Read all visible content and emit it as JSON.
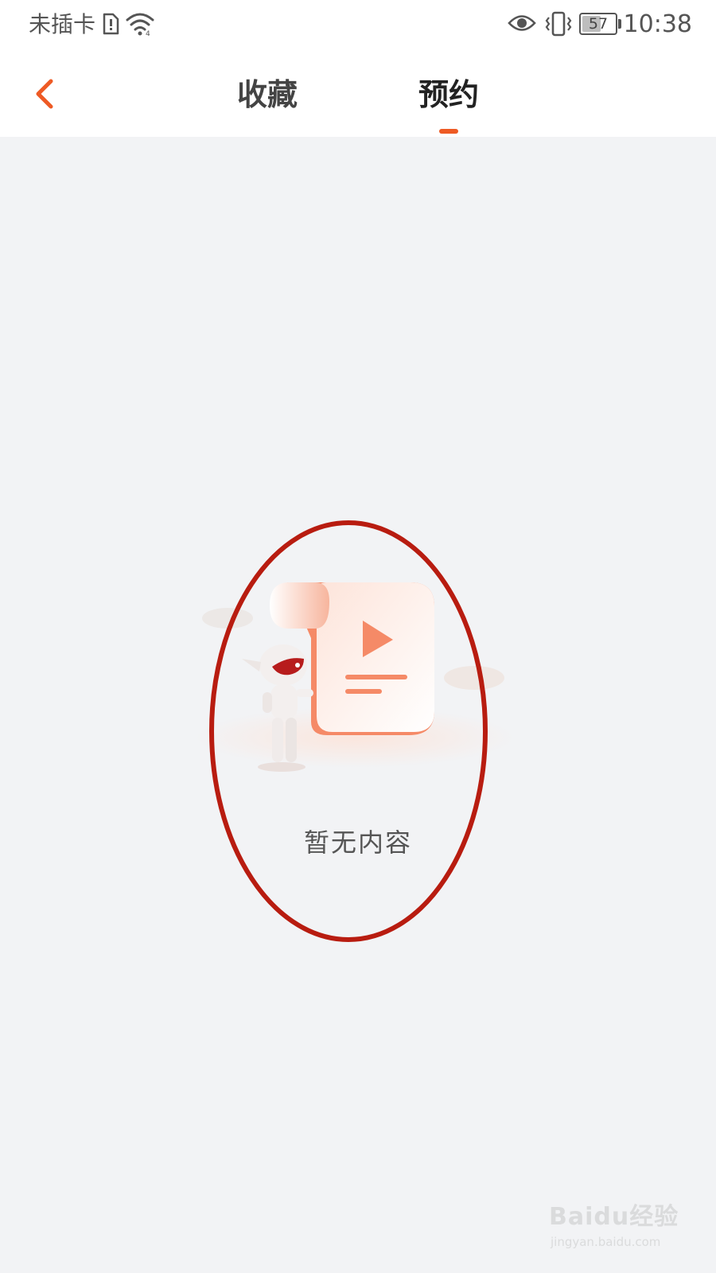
{
  "status_bar": {
    "carrier": "未插卡",
    "battery_level": "57",
    "battery_fraction": 0.57,
    "time": "10:38",
    "icons": [
      "sim-alert-icon",
      "wifi-icon",
      "eye-icon",
      "vibrate-icon",
      "battery-icon"
    ]
  },
  "nav": {
    "back_icon": "chevron-left-icon",
    "tabs": [
      {
        "label": "收藏",
        "active": false
      },
      {
        "label": "预约",
        "active": true
      }
    ]
  },
  "empty_state": {
    "text": "暂无内容",
    "illustration_icon": "empty-video-list-illustration"
  },
  "annotation": {
    "shape": "hand-drawn ellipse highlighting empty state"
  },
  "watermark": {
    "brand": "Baidu经验",
    "url": "jingyan.baidu.com"
  },
  "colors": {
    "accent": "#ee5a24",
    "background": "#f2f3f5",
    "highlight_ellipse": "#b81c10",
    "illustration_orange": "#f58a67"
  }
}
